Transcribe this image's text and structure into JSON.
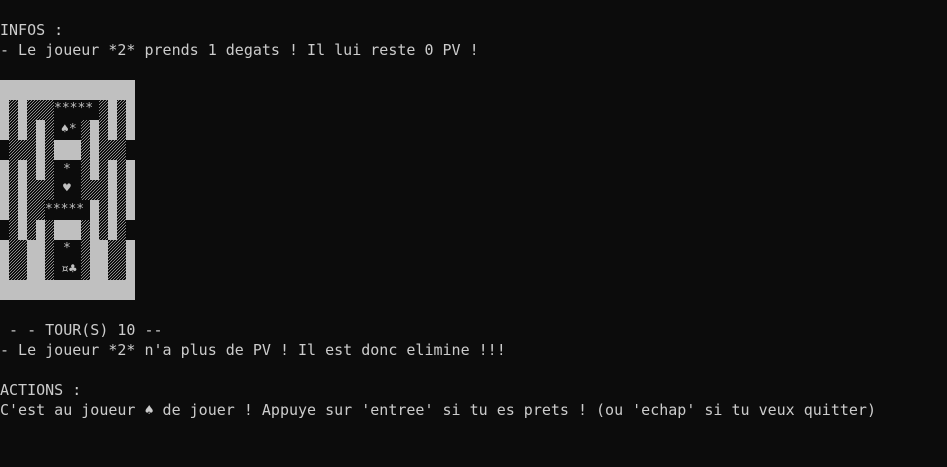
{
  "infos": {
    "header": "INFOS :",
    "message": "- Le joueur *2* prends 1 degats ! Il lui reste 0 PV !"
  },
  "board": {
    "row_stars_top": "*****",
    "row_spade": "♠*",
    "row_star_a": "*",
    "row_heart": "♥",
    "row_stars_mid": "*****",
    "row_star_b": "*",
    "row_bottom": "¤♣"
  },
  "turn": {
    "header": " - - TOUR(S) 10 --",
    "message": "- Le joueur *2* n'a plus de PV ! Il est donc elimine !!!"
  },
  "actions": {
    "header": "ACTIONS :",
    "message": "C'est au joueur ♠ de jouer ! Appuye sur 'entree' si tu es prets ! (ou 'echap' si tu veux quitter)"
  }
}
